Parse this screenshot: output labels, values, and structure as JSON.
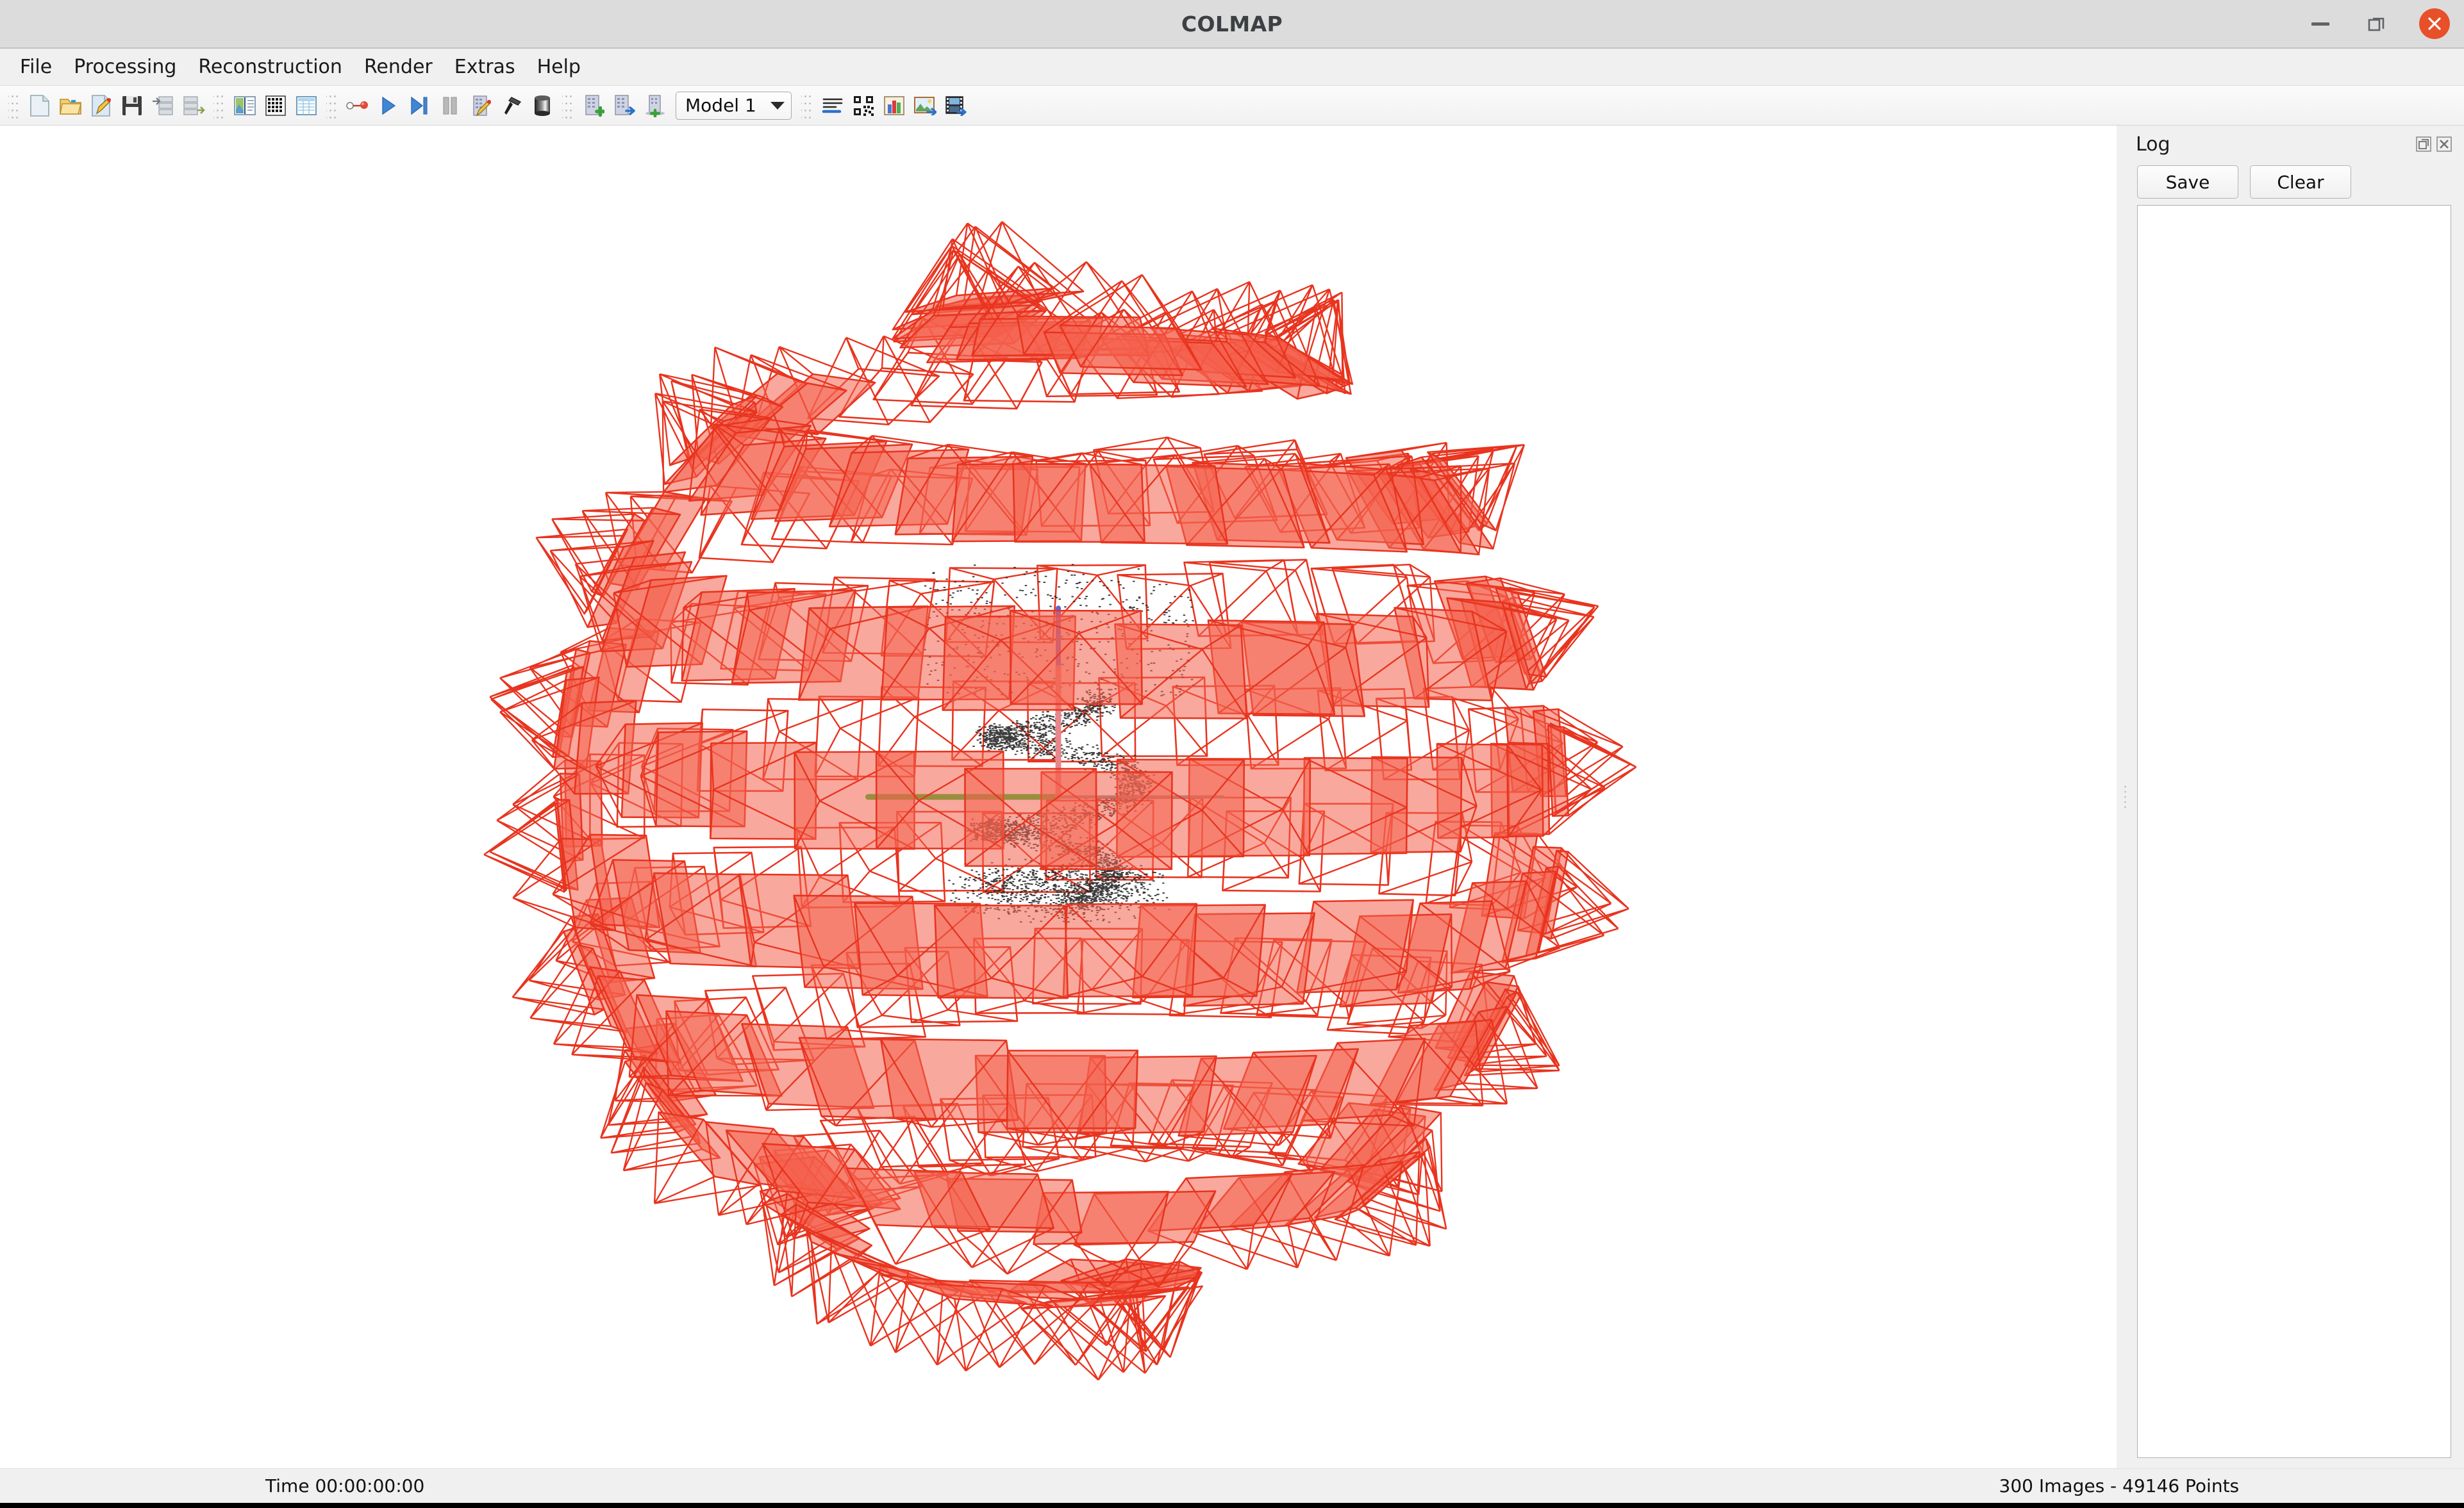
{
  "window": {
    "title": "COLMAP",
    "controls": [
      {
        "name": "minimize",
        "icon": "minimize-icon"
      },
      {
        "name": "maximize",
        "icon": "maximize-icon"
      },
      {
        "name": "close",
        "icon": "close-icon",
        "color": "#e8502a"
      }
    ]
  },
  "menubar": {
    "items": [
      {
        "label": "File"
      },
      {
        "label": "Processing"
      },
      {
        "label": "Reconstruction"
      },
      {
        "label": "Render"
      },
      {
        "label": "Extras"
      },
      {
        "label": "Help"
      }
    ]
  },
  "toolbar": {
    "groups": [
      {
        "items": [
          {
            "name": "new-project-button",
            "icon": "new-document-icon",
            "tooltip": "New project"
          },
          {
            "name": "open-project-button",
            "icon": "open-folder-icon",
            "tooltip": "Open project"
          },
          {
            "name": "edit-project-button",
            "icon": "edit-document-icon",
            "tooltip": "Edit project"
          },
          {
            "name": "save-project-button",
            "icon": "floppy-save-icon",
            "tooltip": "Save project"
          },
          {
            "name": "import-model-button",
            "icon": "database-import-icon",
            "tooltip": "Import model"
          },
          {
            "name": "export-model-button",
            "icon": "database-export-icon",
            "tooltip": "Export model"
          }
        ]
      },
      {
        "items": [
          {
            "name": "feature-extraction-button",
            "icon": "image-pane-icon",
            "tooltip": "Feature extraction"
          },
          {
            "name": "feature-matching-button",
            "icon": "dot-grid-icon",
            "tooltip": "Feature matching"
          },
          {
            "name": "database-management-button",
            "icon": "table-grid-icon",
            "tooltip": "Database management"
          }
        ]
      },
      {
        "items": [
          {
            "name": "automatic-reconstruction-button",
            "icon": "wand-node-icon",
            "tooltip": "Automatic reconstruction"
          },
          {
            "name": "start-reconstruction-button",
            "icon": "play-icon",
            "tooltip": "Start reconstruction"
          },
          {
            "name": "step-reconstruction-button",
            "icon": "step-forward-icon",
            "tooltip": "Reconstruct next image"
          },
          {
            "name": "pause-reconstruction-button",
            "icon": "pause-icon",
            "tooltip": "Pause reconstruction"
          },
          {
            "name": "bundle-adjustment-button",
            "icon": "building-wand-icon",
            "tooltip": "Bundle adjustment"
          },
          {
            "name": "dense-reconstruction-button",
            "icon": "hammer-icon",
            "tooltip": "Dense reconstruction"
          },
          {
            "name": "render-cylinder-button",
            "icon": "cylinder-icon",
            "tooltip": "Render options"
          }
        ]
      },
      {
        "items": [
          {
            "name": "add-model-button",
            "icon": "building-plus-icon",
            "tooltip": "Add model"
          },
          {
            "name": "merge-model-button",
            "icon": "building-arrow-icon",
            "tooltip": "Merge models"
          },
          {
            "name": "align-model-button",
            "icon": "building-align-icon",
            "tooltip": "Align model"
          }
        ]
      }
    ],
    "model_selector": {
      "name": "model-selector",
      "value": "Model 1",
      "options": [
        "Model 1"
      ]
    },
    "right_groups": [
      {
        "items": [
          {
            "name": "model-statistics-button",
            "icon": "text-lines-icon",
            "tooltip": "Model statistics"
          },
          {
            "name": "match-matrix-button",
            "icon": "qr-matrix-icon",
            "tooltip": "Match matrix"
          },
          {
            "name": "model-charts-button",
            "icon": "bar-chart-icon",
            "tooltip": "Show model statistics"
          },
          {
            "name": "grab-image-button",
            "icon": "image-export-icon",
            "tooltip": "Grab image"
          },
          {
            "name": "grab-movie-button",
            "icon": "film-export-icon",
            "tooltip": "Grab movie"
          }
        ]
      }
    ]
  },
  "log_panel": {
    "title": "Log",
    "float_icon": "float-dock-icon",
    "close_icon": "close-dock-icon",
    "save_label": "Save",
    "clear_label": "Clear",
    "content": ""
  },
  "statusbar": {
    "time": "Time 00:00:00:00",
    "stats": "300 Images - 49146 Points"
  },
  "viewport": {
    "name": "model-viewer",
    "background": "#ffffff",
    "camera_color": "#e8341f",
    "camera_fill": "#f4604d",
    "point_color": "#2b2b2b",
    "axes": {
      "x_color": "#22c322",
      "y_color": "#f08a8a",
      "z_color": "#5a5ad6",
      "w_color": "#8c8c8c"
    },
    "image_count": 300,
    "point_count": 49146
  }
}
